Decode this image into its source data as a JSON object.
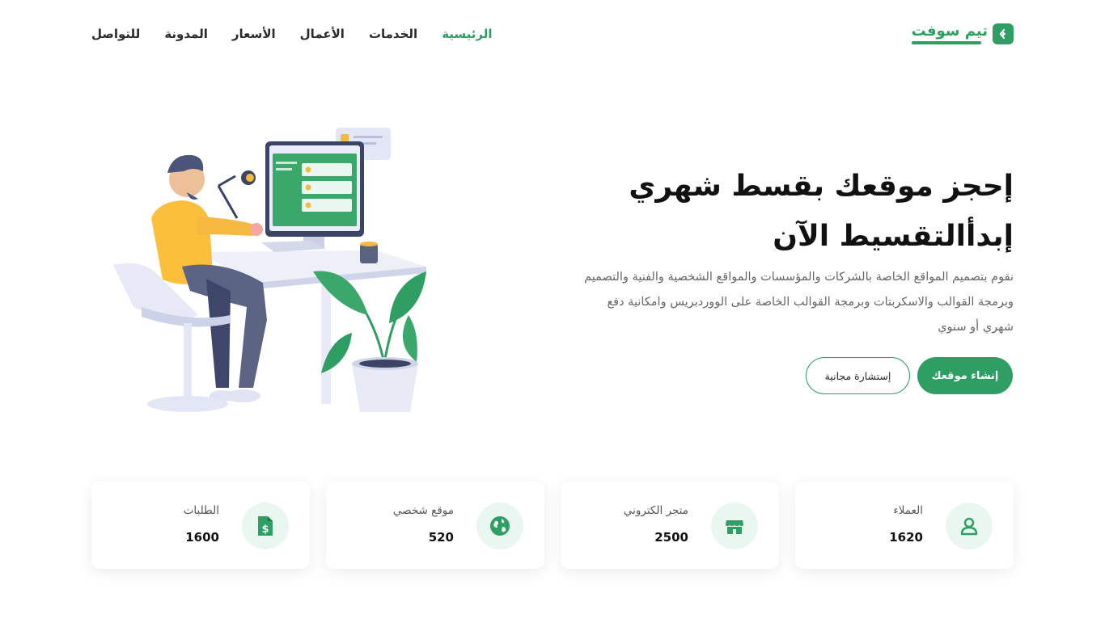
{
  "brand": {
    "name": "تيم سوفت",
    "color": "#2e9e63",
    "icon": "logo-arrows-icon"
  },
  "nav": {
    "items": [
      {
        "label": "الرئيسية",
        "active": true
      },
      {
        "label": "الخدمات",
        "active": false
      },
      {
        "label": "الأعمال",
        "active": false
      },
      {
        "label": "الأسعار",
        "active": false
      },
      {
        "label": "المدونة",
        "active": false
      },
      {
        "label": "للتواصل",
        "active": false
      }
    ]
  },
  "hero": {
    "title_line1": "إحجز موقعك بقسط شهري",
    "title_line2": "إبدأالتقسيط الآن",
    "description": "نقوم بتصميم المواقع الخاصة بالشركات والمؤسسات والمواقع الشخصية والفنية والتصميم وبرمجة القوالب والاسكربتات وبرمجة القوالب الخاصة على الووردبريس وامكانية دفع شهري أو سنوي",
    "primary_button": "إنشاء موقعك",
    "secondary_button": "إستشارة مجانية"
  },
  "stats": [
    {
      "label": "العملاء",
      "value": "1620",
      "icon": "user-icon"
    },
    {
      "label": "متجر الكتروني",
      "value": "2500",
      "icon": "store-icon"
    },
    {
      "label": "موقع شخصي",
      "value": "520",
      "icon": "globe-icon"
    },
    {
      "label": "الطلبات",
      "value": "1600",
      "icon": "dollar-file-icon"
    }
  ]
}
